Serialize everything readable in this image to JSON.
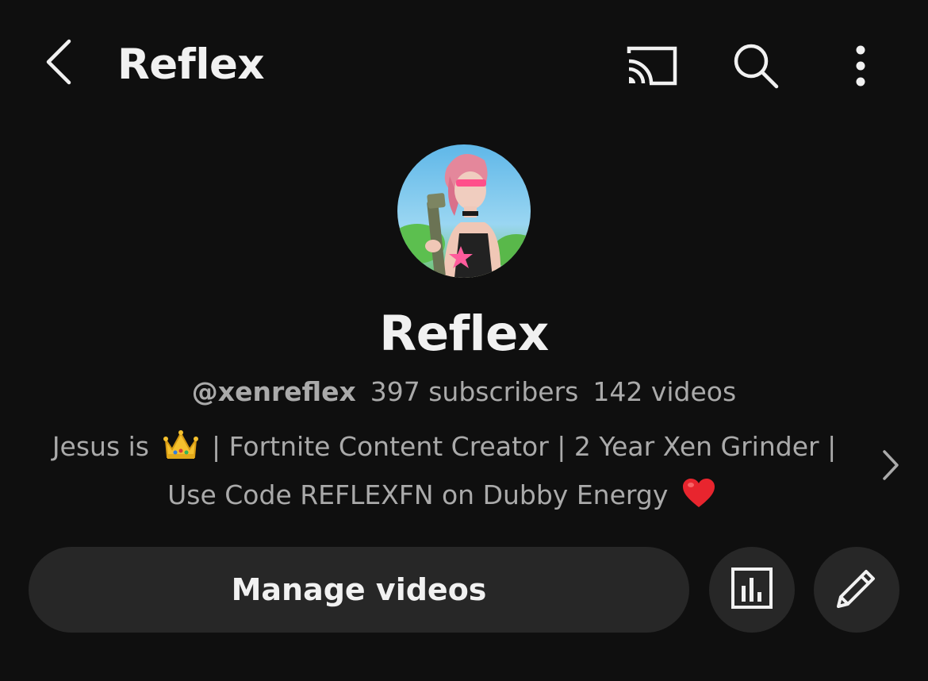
{
  "header": {
    "title": "Reflex",
    "back_icon": "chevron-left-icon",
    "actions": [
      "cast-icon",
      "search-icon",
      "more-vertical-icon"
    ]
  },
  "channel": {
    "name": "Reflex",
    "handle": "@xenreflex",
    "subscribers": "397 subscribers",
    "videos": "142 videos",
    "description_line1_before": "Jesus is",
    "description_line1_after": "| Fortnite Content Creator | 2 Year Xen Grinder |",
    "description_line2": "Use Code REFLEXFN on Dubby Energy",
    "description_emojis": [
      "crown-emoji",
      "red-heart-emoji"
    ]
  },
  "actions": {
    "manage_videos_label": "Manage videos",
    "analytics_icon": "analytics-icon",
    "edit_icon": "pencil-icon"
  },
  "colors": {
    "background": "#0f0f0f",
    "primary_text": "#f1f1f1",
    "secondary_text": "#aaaaaa",
    "button_bg": "#272727"
  }
}
